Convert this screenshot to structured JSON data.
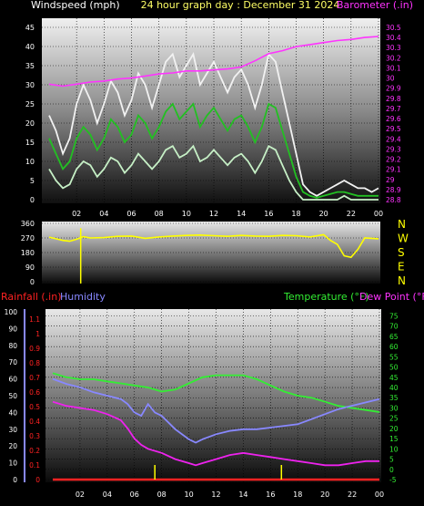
{
  "chart_data": [
    {
      "type": "line",
      "title": "24 hour graph day : December 31 2024",
      "ylabel_left": "Windspeed (mph)",
      "ylabel_right": "Barometer (.in)",
      "x_ticks": [
        "02",
        "04",
        "06",
        "08",
        "10",
        "12",
        "14",
        "16",
        "18",
        "20",
        "22",
        "00"
      ],
      "y_left_ticks": [
        "0",
        "5",
        "10",
        "15",
        "20",
        "25",
        "30",
        "35",
        "40",
        "45"
      ],
      "y_left_range": [
        0,
        45
      ],
      "y_right_ticks": [
        "28.8",
        "28.9",
        "29",
        "29.1",
        "29.2",
        "29.3",
        "29.4",
        "29.5",
        "29.6",
        "29.7",
        "29.8",
        "29.9",
        "30",
        "30.1",
        "30.2",
        "30.3",
        "30.4",
        "30.5"
      ],
      "y_right_range": [
        28.8,
        30.5
      ],
      "x_range_hours": [
        0,
        24
      ],
      "series": [
        {
          "color": "#ff33ff",
          "axis": "right",
          "x": [
            0,
            1,
            2,
            3,
            4,
            5,
            6,
            7,
            8,
            9,
            10,
            11,
            12,
            13,
            14,
            15,
            16,
            17,
            18,
            19,
            20,
            21,
            22,
            23,
            24
          ],
          "values": [
            29.94,
            29.92,
            29.94,
            29.96,
            29.97,
            29.99,
            30.0,
            30.02,
            30.04,
            30.05,
            30.07,
            30.07,
            30.08,
            30.09,
            30.11,
            30.17,
            30.24,
            30.27,
            30.31,
            30.33,
            30.35,
            30.37,
            30.38,
            30.4,
            30.41
          ]
        },
        {
          "color": "#f2f2f2",
          "axis": "left",
          "x": [
            0,
            0.5,
            1,
            1.5,
            2,
            2.5,
            3,
            3.5,
            4,
            4.5,
            5,
            5.5,
            6,
            6.5,
            7,
            7.5,
            8,
            8.5,
            9,
            9.5,
            10,
            10.5,
            11,
            11.5,
            12,
            12.5,
            13,
            13.5,
            14,
            14.5,
            15,
            15.5,
            16,
            16.5,
            17,
            17.5,
            18,
            18.5,
            19,
            19.5,
            20,
            20.5,
            21,
            21.5,
            22,
            22.5,
            23,
            23.5,
            24
          ],
          "values": [
            22,
            18,
            12,
            16,
            25,
            30,
            26,
            20,
            25,
            31,
            28,
            22,
            26,
            33,
            30,
            24,
            30,
            36,
            38,
            32,
            35,
            38,
            30,
            33,
            36,
            32,
            28,
            32,
            34,
            30,
            24,
            30,
            38,
            36,
            28,
            20,
            12,
            4,
            2,
            1,
            2,
            3,
            4,
            5,
            4,
            3,
            3,
            2,
            3
          ]
        },
        {
          "color": "#22c022",
          "axis": "left",
          "x": [
            0,
            0.5,
            1,
            1.5,
            2,
            2.5,
            3,
            3.5,
            4,
            4.5,
            5,
            5.5,
            6,
            6.5,
            7,
            7.5,
            8,
            8.5,
            9,
            9.5,
            10,
            10.5,
            11,
            11.5,
            12,
            12.5,
            13,
            13.5,
            14,
            14.5,
            15,
            15.5,
            16,
            16.5,
            17,
            17.5,
            18,
            18.5,
            19,
            19.5,
            20,
            20.5,
            21,
            21.5,
            22,
            22.5,
            23,
            23.5,
            24
          ],
          "values": [
            16,
            12,
            8,
            10,
            16,
            19,
            17,
            13,
            16,
            21,
            19,
            15,
            17,
            22,
            20,
            16,
            19,
            23,
            25,
            21,
            23,
            25,
            19,
            22,
            24,
            21,
            18,
            21,
            22,
            19,
            15,
            19,
            25,
            24,
            18,
            12,
            6,
            2,
            1,
            0.5,
            1,
            1.5,
            2,
            2,
            1.5,
            1,
            1,
            1,
            1
          ]
        },
        {
          "color": "#c6f0c6",
          "axis": "left",
          "x": [
            0,
            0.5,
            1,
            1.5,
            2,
            2.5,
            3,
            3.5,
            4,
            4.5,
            5,
            5.5,
            6,
            6.5,
            7,
            7.5,
            8,
            8.5,
            9,
            9.5,
            10,
            10.5,
            11,
            11.5,
            12,
            12.5,
            13,
            13.5,
            14,
            14.5,
            15,
            15.5,
            16,
            16.5,
            17,
            17.5,
            18,
            18.5,
            19,
            19.5,
            20,
            20.5,
            21,
            21.5,
            22,
            22.5,
            23,
            23.5,
            24
          ],
          "values": [
            8,
            5,
            3,
            4,
            8,
            10,
            9,
            6,
            8,
            11,
            10,
            7,
            9,
            12,
            10,
            8,
            10,
            13,
            14,
            11,
            12,
            14,
            10,
            11,
            13,
            11,
            9,
            11,
            12,
            10,
            7,
            10,
            14,
            13,
            9,
            5,
            2,
            0,
            0,
            0,
            0,
            0,
            0,
            1,
            0,
            0,
            0,
            0,
            0
          ]
        }
      ]
    },
    {
      "type": "line",
      "title": "",
      "y_left_ticks": [
        "360",
        "270",
        "180",
        "90",
        "0"
      ],
      "y_left_range": [
        0,
        360
      ],
      "y_right_ticks": [
        "N",
        "W",
        "S",
        "E",
        "N"
      ],
      "x_range_hours": [
        0,
        24
      ],
      "series": [
        {
          "color": "#ffff00",
          "x": [
            0,
            0.5,
            1,
            1.5,
            2,
            2.5,
            3,
            4,
            5,
            6,
            7,
            8,
            9,
            10,
            11,
            12,
            13,
            14,
            15,
            16,
            17,
            18,
            19,
            20,
            20.5,
            21,
            21.5,
            22,
            22.5,
            23,
            24
          ],
          "values": [
            275,
            265,
            255,
            250,
            262,
            278,
            270,
            272,
            280,
            282,
            268,
            276,
            282,
            286,
            288,
            284,
            280,
            286,
            282,
            280,
            286,
            284,
            276,
            290,
            255,
            230,
            160,
            150,
            200,
            270,
            265
          ]
        },
        {
          "color": "#ffff00",
          "x": [
            2.3
          ],
          "values": [
            330
          ],
          "bar_to_bottom": true
        }
      ]
    },
    {
      "type": "line",
      "title": "",
      "legend": [
        "Rainfall (.in)",
        "Humidity",
        "Temperature (°F)",
        "Dew Point (°F)"
      ],
      "y_humidity_ticks": [
        "0",
        "10",
        "20",
        "30",
        "40",
        "50",
        "60",
        "70",
        "80",
        "90",
        "100"
      ],
      "y_humidity_range": [
        0,
        100
      ],
      "y_rain_ticks": [
        "0",
        "0.1",
        "0.2",
        "0.3",
        "0.4",
        "0.5",
        "0.6",
        "0.7",
        "0.8",
        "0.9",
        "1",
        "1.1"
      ],
      "y_rain_range": [
        0,
        1.15
      ],
      "y_temp_ticks": [
        "-5",
        "0",
        "5",
        "10",
        "15",
        "20",
        "25",
        "30",
        "35",
        "40",
        "45",
        "50",
        "55",
        "60",
        "65",
        "70",
        "75"
      ],
      "y_temp_range": [
        -5,
        77
      ],
      "x_range_hours": [
        0,
        24
      ],
      "series": [
        {
          "name": "Temperature (°F)",
          "color": "#33ee33",
          "axis": "temp",
          "x": [
            0,
            1,
            2,
            3,
            4,
            5,
            6,
            7,
            8,
            9,
            10,
            11,
            12,
            13,
            14,
            15,
            16,
            17,
            18,
            19,
            20,
            21,
            22,
            23,
            24
          ],
          "values": [
            47,
            45,
            44,
            44,
            43,
            42,
            41,
            40,
            38,
            39,
            42,
            45,
            46,
            46,
            46,
            44,
            41,
            38,
            36,
            35,
            33,
            31,
            30,
            29,
            28
          ]
        },
        {
          "name": "Dew Point (°F)",
          "color": "#ee22ee",
          "axis": "temp",
          "x": [
            0,
            1,
            2,
            3,
            4,
            5,
            5.5,
            6,
            6.5,
            7,
            8,
            9,
            10,
            10.5,
            11,
            12,
            13,
            14,
            15,
            16,
            17,
            18,
            19,
            20,
            21,
            22,
            23,
            24
          ],
          "values": [
            33,
            31,
            30,
            29,
            27,
            24,
            20,
            15,
            12,
            10,
            8,
            5,
            3,
            2,
            3,
            5,
            7,
            8,
            7,
            6,
            5,
            4,
            3,
            2,
            2,
            3,
            4,
            4
          ]
        },
        {
          "name": "Humidity",
          "color": "#8888ff",
          "axis": "humidity",
          "x": [
            0,
            1,
            2,
            3,
            4,
            5,
            5.5,
            6,
            6.5,
            7,
            7.5,
            8,
            9,
            10,
            10.5,
            11,
            12,
            13,
            14,
            15,
            16,
            17,
            18,
            19,
            20,
            21,
            22,
            23,
            24
          ],
          "values": [
            60,
            57,
            55,
            52,
            50,
            48,
            45,
            40,
            38,
            45,
            40,
            38,
            30,
            24,
            22,
            24,
            27,
            29,
            30,
            30,
            31,
            32,
            33,
            36,
            39,
            42,
            44,
            46,
            48
          ]
        },
        {
          "name": "Rainfall (.in)",
          "color": "#ff2222",
          "axis": "rain",
          "x": [
            0,
            24
          ],
          "values": [
            0,
            0
          ]
        },
        {
          "name": "Rain events",
          "color": "#ffff00",
          "axis": "rain",
          "x": [
            7.5,
            16.8
          ],
          "values": [
            0.1,
            0.1
          ],
          "bar_to_bottom": true
        }
      ]
    }
  ],
  "colors": {
    "title": "#ffff66",
    "windspeed_label": "#ffffff",
    "barometer_label": "#ff33ff",
    "rainfall_label": "#ff2222",
    "humidity_label": "#8888ff",
    "temperature_label": "#33ee33",
    "dewpoint_label": "#ff33ff",
    "axis_tick": "#ffffff",
    "direction_right": "#ffff00"
  }
}
